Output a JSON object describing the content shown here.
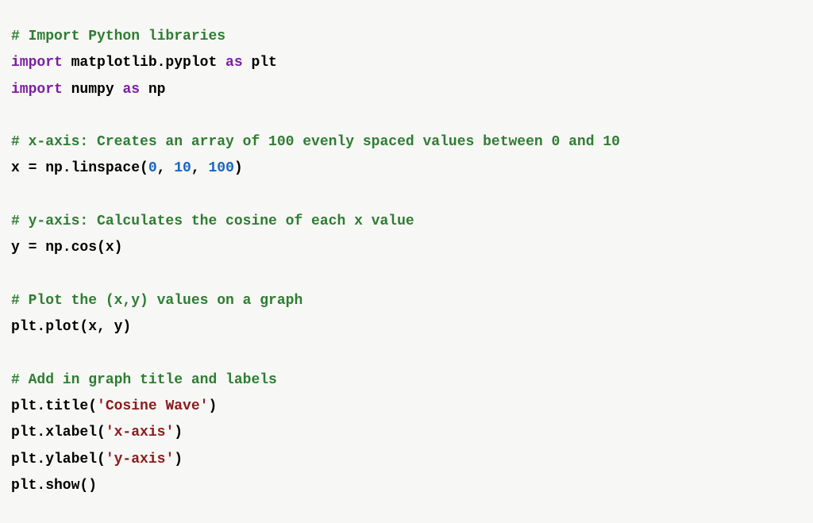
{
  "code": {
    "c1": "# Import Python libraries",
    "kw_import1": "import",
    "l2a": " matplotlib.pyplot ",
    "kw_as1": "as",
    "l2b": " plt",
    "kw_import2": "import",
    "l3a": " numpy ",
    "kw_as2": "as",
    "l3b": " np",
    "c2": "# x-axis: Creates an array of 100 evenly spaced values between 0 and 10",
    "l6a": "x = np.linspace(",
    "n0": "0",
    "comma": ", ",
    "n10": "10",
    "n100": "100",
    "rparen": ")",
    "c3": "# y-axis: Calculates the cosine of each x value",
    "l9": "y = np.cos(x)",
    "c4": "# Plot the (x,y) values on a graph",
    "l12": "plt.plot(x, y)",
    "c5": "# Add in graph title and labels",
    "l15a": "plt.title(",
    "s_title": "'Cosine Wave'",
    "l16a": "plt.xlabel(",
    "s_xlabel": "'x-axis'",
    "l17a": "plt.ylabel(",
    "s_ylabel": "'y-axis'",
    "l18": "plt.show()"
  }
}
